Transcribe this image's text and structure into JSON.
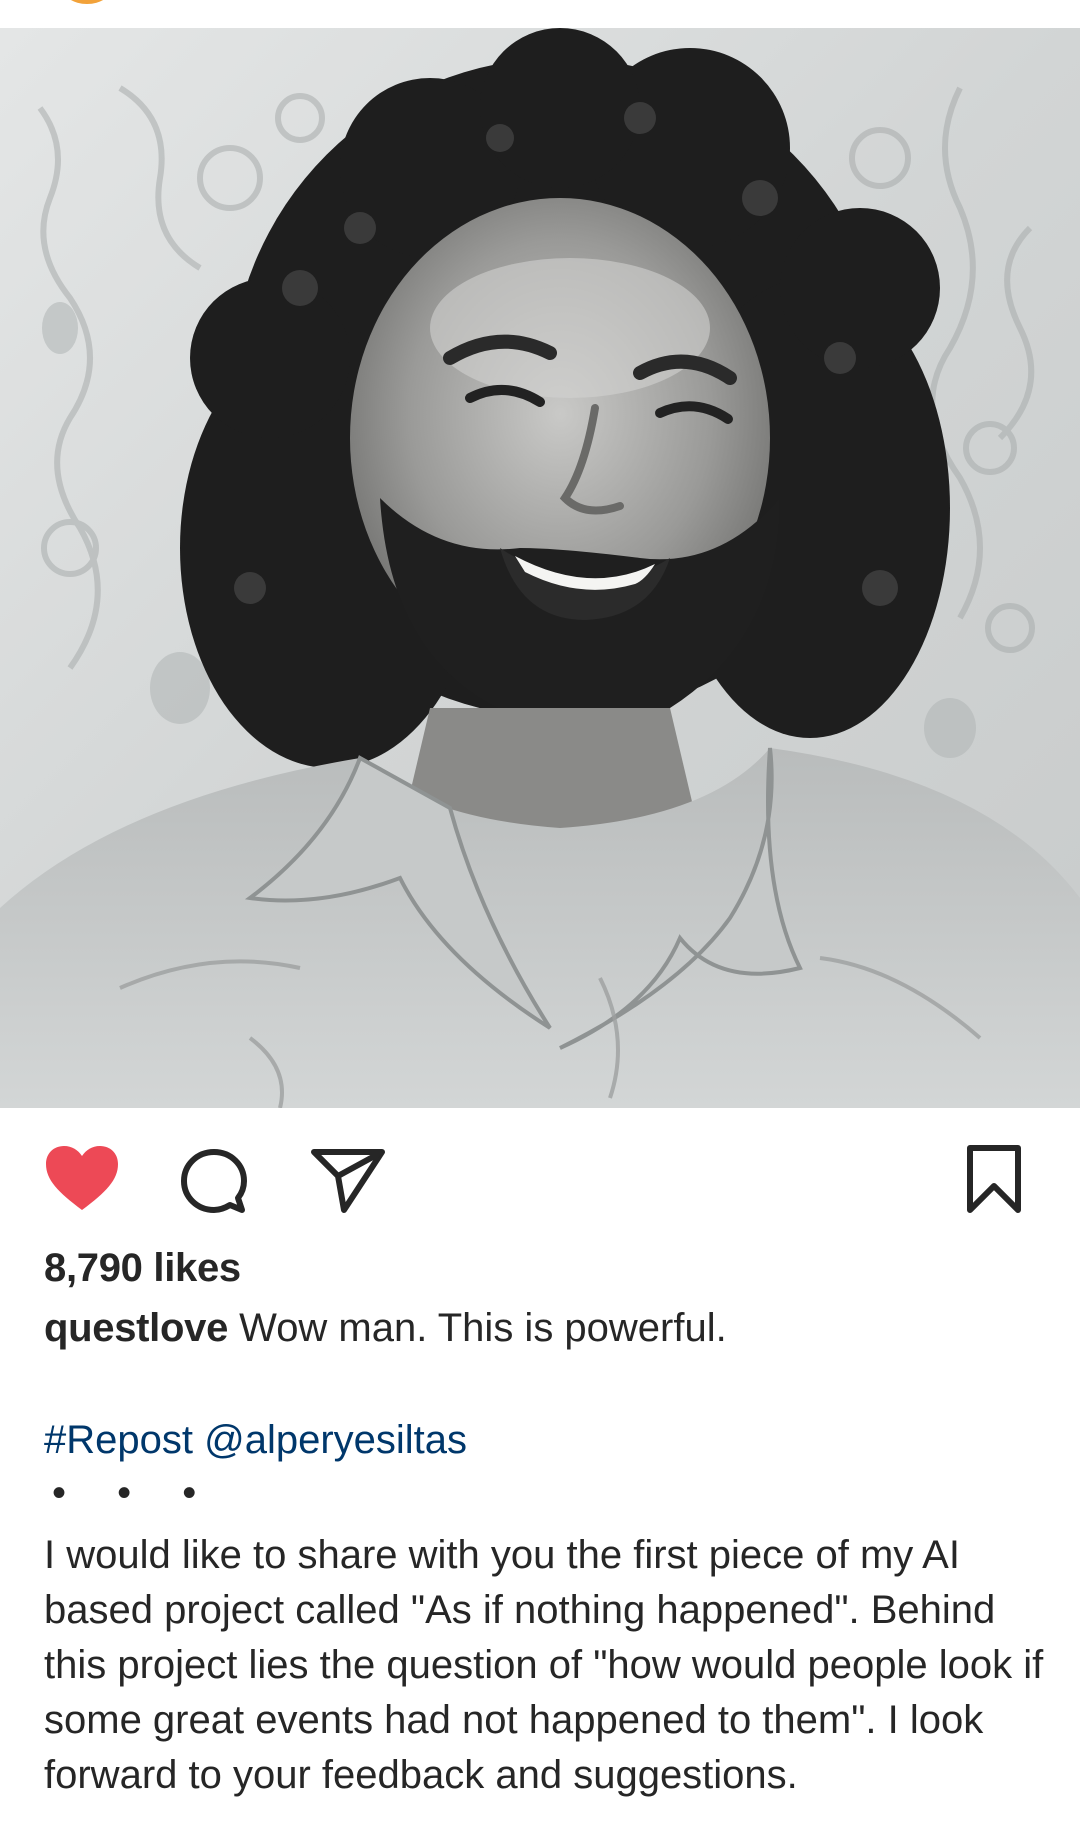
{
  "post": {
    "likes_text": "8,790 likes",
    "caption": {
      "username": "questlove",
      "text": "Wow man. This is powerful."
    },
    "repost": {
      "hashtag": "#Repost",
      "mention": "@alperyesiltas"
    },
    "ellipsis": "• • •",
    "description": "I would like to share with you the first piece of my AI based project called \"As if nothing happened\". Behind this project lies the question of \"how would people look if some great events had not happened to them\". I look forward to your feedback and suggestions.",
    "liked": true,
    "colors": {
      "like_active": "#ed4956",
      "link": "#00376b",
      "text": "#262626"
    }
  },
  "icons": {
    "like": "heart-icon",
    "comment": "comment-bubble-icon",
    "share": "paper-plane-icon",
    "save": "bookmark-icon"
  }
}
